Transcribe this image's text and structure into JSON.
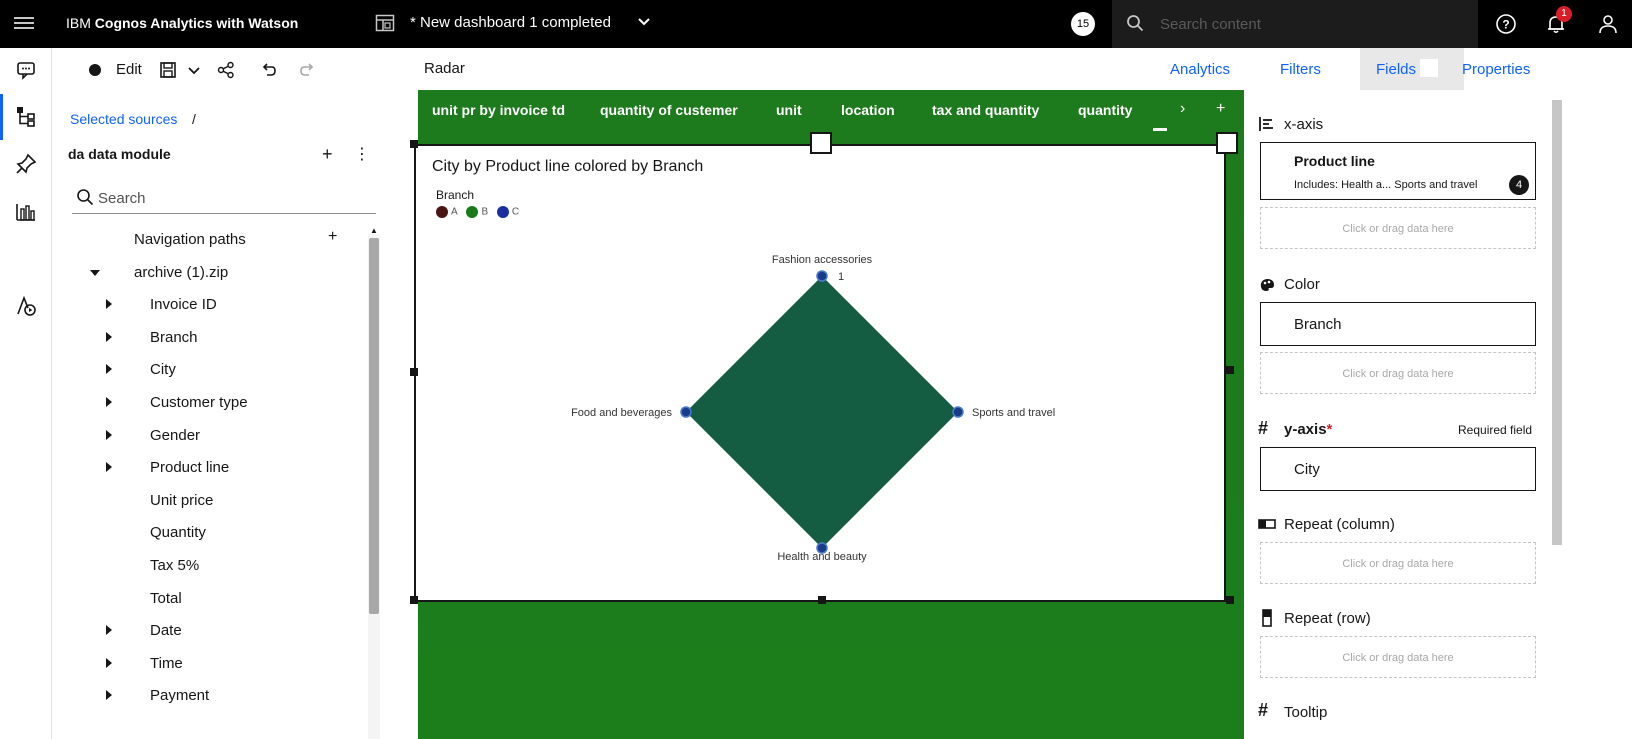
{
  "topbar": {
    "app_title_prefix": "IBM ",
    "app_title_bold": "Cognos Analytics with Watson",
    "dashboard_title": "* New dashboard 1 completed",
    "counter": "15",
    "search_placeholder": "Search content",
    "notification_count": "1"
  },
  "toolbar": {
    "edit_label": "Edit"
  },
  "source_panel": {
    "breadcrumb": "Selected sources",
    "breadcrumb_sep": "/",
    "module_title": "da data module",
    "search_placeholder": "Search",
    "tree": [
      {
        "label": "Navigation paths",
        "caret": "none"
      },
      {
        "label": "archive (1).zip",
        "caret": "down"
      },
      {
        "label": "Invoice ID",
        "caret": "right"
      },
      {
        "label": "Branch",
        "caret": "right"
      },
      {
        "label": "City",
        "caret": "right"
      },
      {
        "label": "Customer type",
        "caret": "right"
      },
      {
        "label": "Gender",
        "caret": "right"
      },
      {
        "label": "Product line",
        "caret": "right"
      },
      {
        "label": "Unit price",
        "caret": "none"
      },
      {
        "label": "Quantity",
        "caret": "none"
      },
      {
        "label": "Tax 5%",
        "caret": "none"
      },
      {
        "label": "Total",
        "caret": "none"
      },
      {
        "label": "Date",
        "caret": "right"
      },
      {
        "label": "Time",
        "caret": "right"
      },
      {
        "label": "Payment",
        "caret": "right"
      }
    ]
  },
  "canvas": {
    "visualization_name": "Radar",
    "tabs": [
      "unit pr by invoice td",
      "quantity of custemer",
      "unit",
      "location",
      "tax and quantity",
      "quantity"
    ],
    "add_tab": "+",
    "bg_color": "#1b7d1b"
  },
  "chart_data": {
    "type": "radar",
    "title": "City by Product line colored by Branch",
    "legend_title": "Branch",
    "legend": [
      {
        "name": "A",
        "color": "#4a1414"
      },
      {
        "name": "B",
        "color": "#1a7a1a"
      },
      {
        "name": "C",
        "color": "#1a2fa0"
      }
    ],
    "categories": [
      "Fashion accessories",
      "Sports and travel",
      "Health and beauty",
      "Food and beverages"
    ],
    "radial_tick": "1",
    "fill_color": "#145c42"
  },
  "right_panel": {
    "tabs": [
      "Analytics",
      "Filters",
      "Fields",
      "Properties"
    ],
    "active_tab": "Fields",
    "xaxis": {
      "heading": "x-axis",
      "field": "Product line",
      "includes": "Includes: Health a... Sports and travel",
      "count": "4"
    },
    "drop_hint": "Click or drag data here",
    "color": {
      "heading": "Color",
      "field": "Branch"
    },
    "yaxis": {
      "heading": "y-axis",
      "required_mark": "*",
      "required_text": "Required field",
      "field": "City"
    },
    "repeat_column": {
      "heading": "Repeat (column)"
    },
    "repeat_row": {
      "heading": "Repeat (row)"
    },
    "tooltip_heading": "Tooltip"
  }
}
